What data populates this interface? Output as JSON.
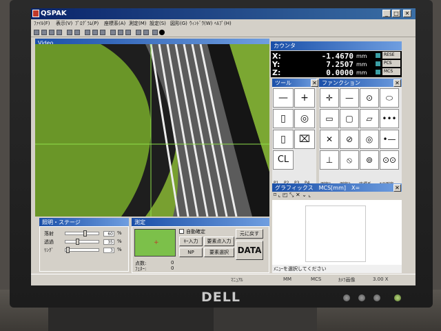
{
  "monitor": {
    "brand": "DELL"
  },
  "window": {
    "title": "QSPAK",
    "min": "_",
    "max": "□",
    "close": "✕"
  },
  "menus": [
    "ﾌｧｲﾙ(F)",
    "表示(V)",
    "ﾌﾟﾛｸﾞﾗﾑ(P)",
    "座標系(A)",
    "測定(M)",
    "設定(S)",
    "図形(G)",
    "ｳｨﾝﾄﾞｳ(W)",
    "ﾍﾙﾌﾟ(H)"
  ],
  "video": {
    "title": "Video"
  },
  "counter": {
    "title": "カウンタ",
    "axes": [
      {
        "label": "X:",
        "value": "-1.4670",
        "unit": "mm",
        "button": "RESE"
      },
      {
        "label": "Y:",
        "value": "7.2507",
        "unit": "mm",
        "button": "PCS"
      },
      {
        "label": "Z:",
        "value": "0.0000",
        "unit": "mm",
        "button": "MCS"
      }
    ]
  },
  "tools": {
    "title": "ツール",
    "close": "✕",
    "cl": "CL",
    "tabs": [
      "P1",
      "P2",
      "P3",
      "P4"
    ]
  },
  "functions": {
    "title": "ファンクション",
    "close": "✕",
    "tabs": [
      "測定1",
      "測定2",
      "座標系",
      "NP測定"
    ]
  },
  "graphics": {
    "title": "グラフィックス　MCS[mm]　X=",
    "hint": "ﾒﾆｭｰを選択してください"
  },
  "lighting": {
    "title": "照明・ステージ",
    "rows": [
      {
        "label": "落射",
        "value": "60",
        "pct": "%",
        "level": 0.6
      },
      {
        "label": "透過",
        "value": "35",
        "pct": "%",
        "level": 0.35
      },
      {
        "label": "ﾘﾝｸﾞ",
        "value": "3",
        "pct": "%",
        "level": 0.03
      }
    ]
  },
  "measure": {
    "title": "測定",
    "auto_confirm": "自動確定",
    "key_input": "ｷｰ入力",
    "element_point_input": "要素点入力",
    "restore": "元に戻す",
    "np": "NP",
    "element_select": "要素選択",
    "data": "DATA",
    "points_label": "点数:",
    "points_value": "0",
    "side_label": "ﾌｪﾇｰ:",
    "side_value": "0"
  },
  "status": {
    "manual": "ﾏﾆｭｱﾙ",
    "unit": "MM",
    "coord": "MCS",
    "camera": "ｶﾒﾗ画像",
    "zoom": "3.00 X"
  }
}
